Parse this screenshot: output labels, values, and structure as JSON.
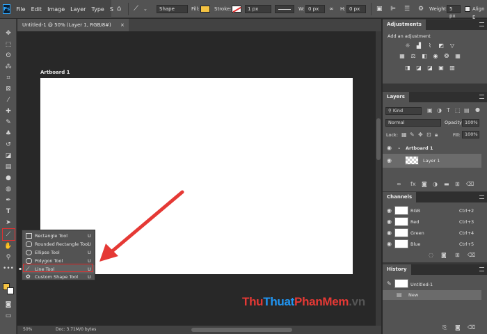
{
  "menu": {
    "logo": "Ps",
    "items": [
      "File",
      "Edit",
      "Image",
      "Layer",
      "Type",
      "S"
    ]
  },
  "options": {
    "mode": "Shape",
    "fill_label": "Fill:",
    "stroke_label": "Stroke:",
    "stroke_width": "1 px",
    "w_label": "W:",
    "w_value": "0 px",
    "h_label": "H:",
    "h_value": "0 px",
    "weight_label": "Weight:",
    "weight_value": "5 px",
    "align_label": "Align E",
    "fill_color": "#f5c342"
  },
  "document": {
    "tab_title": "Untitled-1 @ 50% (Layer 1, RGB/8#)",
    "artboard_label": "Artboard 1",
    "zoom": "50%",
    "doc_info": "Doc: 3.71M/0 bytes"
  },
  "flyout": {
    "items": [
      {
        "label": "Rectangle Tool",
        "key": "U"
      },
      {
        "label": "Rounded Rectangle Tool",
        "key": "U"
      },
      {
        "label": "Ellipse Tool",
        "key": "U"
      },
      {
        "label": "Polygon Tool",
        "key": "U"
      },
      {
        "label": "Line Tool",
        "key": "U"
      },
      {
        "label": "Custom Shape Tool",
        "key": "U"
      }
    ],
    "selected_index": 4
  },
  "adjustments": {
    "title": "Adjustments",
    "subtitle": "Add an adjustment"
  },
  "layers": {
    "title": "Layers",
    "filter": "Kind",
    "blend_mode": "Normal",
    "opacity_label": "Opacity:",
    "opacity_value": "100%",
    "lock_label": "Lock:",
    "fill_label": "Fill:",
    "fill_value": "100%",
    "artboard_name": "Artboard 1",
    "layer_name": "Layer 1"
  },
  "channels": {
    "title": "Channels",
    "items": [
      {
        "label": "RGB",
        "key": "Ctrl+2"
      },
      {
        "label": "Red",
        "key": "Ctrl+3"
      },
      {
        "label": "Green",
        "key": "Ctrl+4"
      },
      {
        "label": "Blue",
        "key": "Ctrl+5"
      }
    ]
  },
  "history": {
    "title": "History",
    "snapshot": "Untitled-1",
    "step": "New"
  },
  "watermark": {
    "part1": "Thu",
    "part2": "Thuat",
    "part3": "PhanMem",
    "part4": ".vn"
  }
}
